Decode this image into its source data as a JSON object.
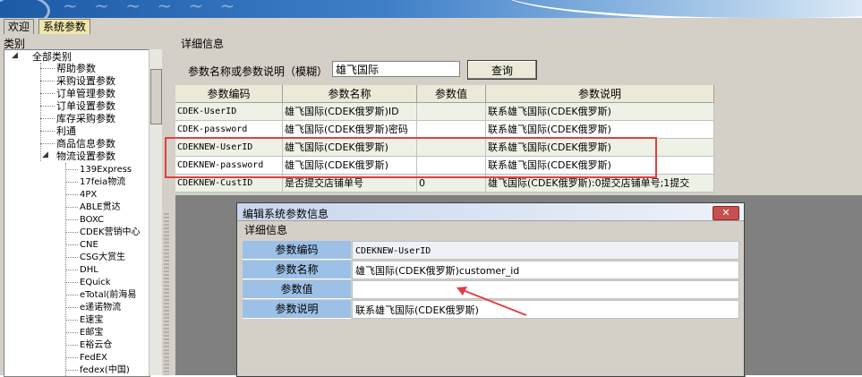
{
  "tabs": [
    {
      "label": "欢迎"
    },
    {
      "label": "系统参数"
    }
  ],
  "left_panel": {
    "title": "类别",
    "tree": {
      "root": "全部类别",
      "groups": [
        "帮助参数",
        "采购设置参数",
        "订单管理参数",
        "订单设置参数",
        "库存采购参数",
        "利通",
        "商品信息参数",
        "物流设置参数"
      ],
      "logistics_children": [
        "139Express",
        "17feia物流",
        "4PX",
        "ABLE贯达",
        "BOXC",
        "CDEK营销中心",
        "CNE",
        "CSG大赏生",
        "DHL",
        "EQuick",
        "eTotal(前海易",
        "e递诺物流",
        "E速宝",
        "E邮宝",
        "E裕云仓",
        "FedEX",
        "fedex(中国)"
      ]
    }
  },
  "right_panel": {
    "title": "详细信息",
    "search": {
      "label": "参数名称或参数说明（模糊）",
      "value": "雄飞国际",
      "button": "查询"
    },
    "grid": {
      "headers": [
        "参数编码",
        "参数名称",
        "参数值",
        "参数说明"
      ],
      "rows": [
        [
          "CDEK-UserID",
          "雄飞国际(CDEK俄罗斯)ID",
          "",
          "联系雄飞国际(CDEK俄罗斯)"
        ],
        [
          "CDEK-password",
          "雄飞国际(CDEK俄罗斯)密码",
          "",
          "联系雄飞国际(CDEK俄罗斯)"
        ],
        [
          "CDEKNEW-UserID",
          "雄飞国际(CDEK俄罗斯)",
          "",
          "联系雄飞国际(CDEK俄罗斯)"
        ],
        [
          "CDEKNEW-password",
          "雄飞国际(CDEK俄罗斯)",
          "",
          "联系雄飞国际(CDEK俄罗斯)"
        ],
        [
          "CDEKNEW-CustID",
          "是否提交店铺单号",
          "0",
          "雄飞国际(CDEK俄罗斯):0提交店铺单号;1提交"
        ]
      ]
    }
  },
  "dialog": {
    "title": "编辑系统参数信息",
    "close_label": "✕",
    "subtitle": "详细信息",
    "fields": [
      {
        "label": "参数编码",
        "value": "CDEKNEW-UserID"
      },
      {
        "label": "参数名称",
        "value": "雄飞国际(CDEK俄罗斯)customer_id"
      },
      {
        "label": "参数值",
        "value": ""
      },
      {
        "label": "参数说明",
        "value": "联系雄飞国际(CDEK俄罗斯)"
      }
    ]
  },
  "colors": {
    "highlight_box": "#e04040",
    "annotation_arrow": "#e04040",
    "form_label_bg": "#9cc0e6",
    "active_tab": "#f0e6a8"
  }
}
